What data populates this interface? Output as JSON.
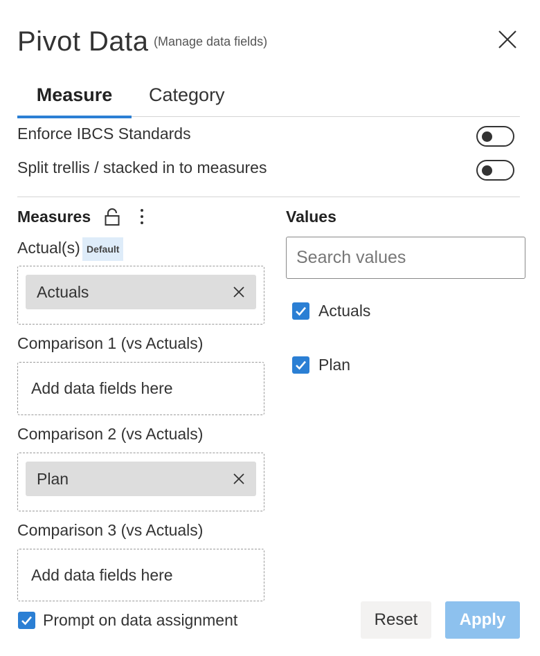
{
  "header": {
    "title": "Pivot Data",
    "subtitle": "(Manage data fields)"
  },
  "tabs": [
    {
      "label": "Measure",
      "active": true
    },
    {
      "label": "Category",
      "active": false
    }
  ],
  "settings": [
    {
      "label": "Enforce IBCS Standards",
      "enabled": false
    },
    {
      "label": "Split trellis / stacked in to measures",
      "enabled": false
    }
  ],
  "measures": {
    "heading": "Measures",
    "groups": [
      {
        "label": "Actual(s)",
        "badge": "Default",
        "chip": "Actuals",
        "placeholder": ""
      },
      {
        "label": "Comparison 1 (vs Actuals)",
        "chip": "",
        "placeholder": "Add data fields here"
      },
      {
        "label": "Comparison 2 (vs Actuals)",
        "chip": "Plan",
        "placeholder": ""
      },
      {
        "label": "Comparison 3 (vs Actuals)",
        "chip": "",
        "placeholder": "Add data fields here"
      }
    ]
  },
  "values": {
    "heading": "Values",
    "search_placeholder": "Search values",
    "items": [
      {
        "label": "Actuals",
        "checked": true
      },
      {
        "label": "Plan",
        "checked": true
      }
    ]
  },
  "footer": {
    "prompt_label": "Prompt on data assignment",
    "prompt_checked": true,
    "reset_label": "Reset",
    "apply_label": "Apply"
  },
  "colors": {
    "accent": "#2b7fd4",
    "apply_disabled": "#8dc1ee",
    "chip_bg": "#dddddd",
    "badge_bg": "#deecf9"
  }
}
